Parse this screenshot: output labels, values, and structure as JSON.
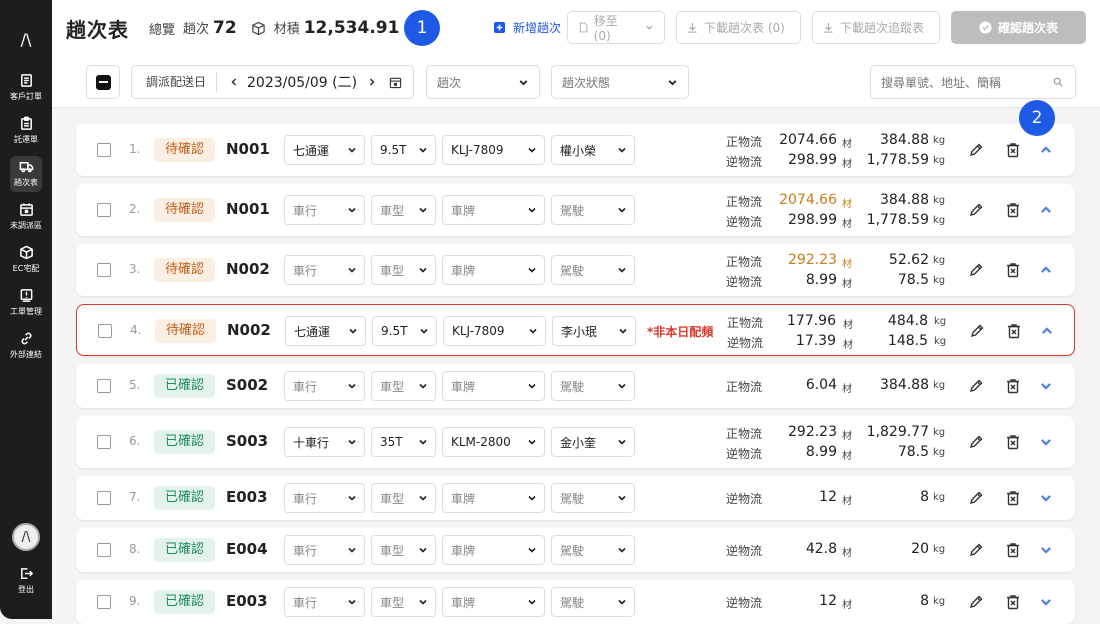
{
  "sidebar": {
    "logo": "/\\",
    "items": [
      {
        "label": "客戶訂單",
        "icon": "orders-icon"
      },
      {
        "label": "託運單",
        "icon": "clipboard-icon"
      },
      {
        "label": "趟次表",
        "icon": "truck-icon",
        "active": true
      },
      {
        "label": "未調派區",
        "icon": "calendar-icon"
      },
      {
        "label": "EC宅配",
        "icon": "box-icon"
      },
      {
        "label": "工單管理",
        "icon": "alert-doc-icon"
      },
      {
        "label": "外部連結",
        "icon": "link-icon"
      }
    ],
    "logout": "登出"
  },
  "header": {
    "title": "趟次表",
    "overview_label": "總覽",
    "trips_label": "趟次",
    "trips_value": "72",
    "volume_label": "材積",
    "volume_value": "12,534.91",
    "marker1": "1",
    "marker2": "2",
    "new_trip": "新增趟次",
    "move_to": "移至 (0)",
    "download_trips": "下載趟次表 (0)",
    "download_tracking": "下載趟次追蹤表",
    "confirm": "確認趟次表"
  },
  "toolbar": {
    "date_label": "調派配送日",
    "date_value": "2023/05/09 (二)",
    "trip_filter": "趟次",
    "status_filter": "趟次狀態",
    "search_placeholder": "搜尋單號、地址、簡稱"
  },
  "labels": {
    "forward": "正物流",
    "reverse": "逆物流",
    "cai": "材",
    "kg": "kg"
  },
  "rows": [
    {
      "idx": "1.",
      "status": "待確認",
      "code": "N001",
      "company": "七通運",
      "type": "9.5T",
      "plate": "KLJ-7809",
      "driver": "權小榮",
      "note": "",
      "fwd_vol": "2074.66",
      "fwd_kg": "384.88",
      "rev_vol": "298.99",
      "rev_kg": "1,778.59"
    },
    {
      "idx": "2.",
      "status": "待確認",
      "code": "N001",
      "company": "車行",
      "type": "車型",
      "plate": "車牌",
      "driver": "駕駛",
      "note": "",
      "fwd_vol": "2074.66",
      "fwd_kg": "384.88",
      "rev_vol": "298.99",
      "rev_kg": "1,778.59"
    },
    {
      "idx": "3.",
      "status": "待確認",
      "code": "N002",
      "company": "車行",
      "type": "車型",
      "plate": "車牌",
      "driver": "駕駛",
      "note": "",
      "fwd_vol": "292.23",
      "fwd_kg": "52.62",
      "rev_vol": "8.99",
      "rev_kg": "78.5"
    },
    {
      "idx": "4.",
      "status": "待確認",
      "code": "N002",
      "company": "七通運",
      "type": "9.5T",
      "plate": "KLJ-7809",
      "driver": "李小珉",
      "note": "*非本日配頻",
      "fwd_vol": "177.96",
      "fwd_kg": "484.8",
      "rev_vol": "17.39",
      "rev_kg": "148.5"
    },
    {
      "idx": "5.",
      "status": "已確認",
      "code": "S002",
      "company": "車行",
      "type": "車型",
      "plate": "車牌",
      "driver": "駕駛",
      "note": "",
      "fwd_vol": "6.04",
      "fwd_kg": "384.88"
    },
    {
      "idx": "6.",
      "status": "已確認",
      "code": "S003",
      "company": "十車行",
      "type": "35T",
      "plate": "KLM-2800",
      "driver": "金小奎",
      "note": "",
      "fwd_vol": "292.23",
      "fwd_kg": "1,829.77",
      "rev_vol": "8.99",
      "rev_kg": "78.5"
    },
    {
      "idx": "7.",
      "status": "已確認",
      "code": "E003",
      "company": "車行",
      "type": "車型",
      "plate": "車牌",
      "driver": "駕駛",
      "note": "",
      "rev_vol": "12",
      "rev_kg": "8"
    },
    {
      "idx": "8.",
      "status": "已確認",
      "code": "E004",
      "company": "車行",
      "type": "車型",
      "plate": "車牌",
      "driver": "駕駛",
      "note": "",
      "rev_vol": "42.8",
      "rev_kg": "20"
    },
    {
      "idx": "9.",
      "status": "已確認",
      "code": "E003",
      "company": "車行",
      "type": "車型",
      "plate": "車牌",
      "driver": "駕駛",
      "note": "",
      "rev_vol": "12",
      "rev_kg": "8"
    }
  ],
  "colors": {
    "accent": "#1e5ae6",
    "pending": "#c0601a",
    "confirmed": "#1f8a5c",
    "alert": "#d93a2e",
    "warn_value": "#c87d14"
  }
}
